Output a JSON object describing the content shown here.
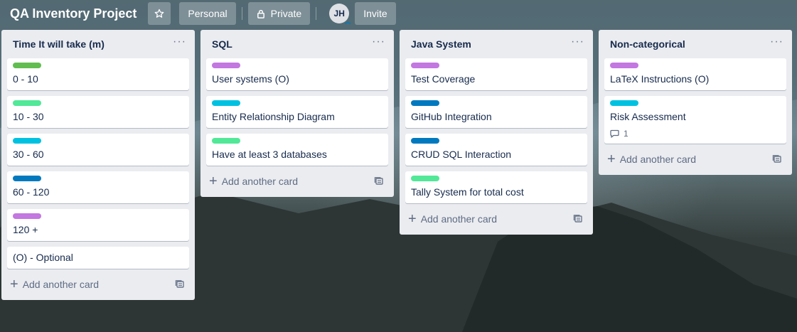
{
  "header": {
    "board_title": "QA Inventory Project",
    "personal_label": "Personal",
    "private_label": "Private",
    "avatar_initials": "JH",
    "invite_label": "Invite"
  },
  "colors": {
    "green": "#61bd4f",
    "lime": "#51e898",
    "sky": "#00c2e0",
    "blue": "#0079bf",
    "purple": "#c377e0"
  },
  "lists": [
    {
      "title": "Time It will take (m)",
      "cards": [
        {
          "label_color": "#61bd4f",
          "text": "0 - 10"
        },
        {
          "label_color": "#51e898",
          "text": "10 - 30"
        },
        {
          "label_color": "#00c2e0",
          "text": "30 - 60"
        },
        {
          "label_color": "#0079bf",
          "text": "60 - 120"
        },
        {
          "label_color": "#c377e0",
          "text": "120 +"
        },
        {
          "label_color": null,
          "text": "(O) - Optional"
        }
      ],
      "add_label": "Add another card"
    },
    {
      "title": "SQL",
      "cards": [
        {
          "label_color": "#c377e0",
          "text": "User systems (O)"
        },
        {
          "label_color": "#00c2e0",
          "text": "Entity Relationship Diagram"
        },
        {
          "label_color": "#51e898",
          "text": "Have at least 3 databases"
        }
      ],
      "add_label": "Add another card"
    },
    {
      "title": "Java System",
      "cards": [
        {
          "label_color": "#c377e0",
          "text": "Test Coverage"
        },
        {
          "label_color": "#0079bf",
          "text": "GitHub Integration"
        },
        {
          "label_color": "#0079bf",
          "text": "CRUD SQL Interaction"
        },
        {
          "label_color": "#51e898",
          "text": "Tally System for total cost"
        }
      ],
      "add_label": "Add another card"
    },
    {
      "title": "Non-categorical",
      "cards": [
        {
          "label_color": "#c377e0",
          "text": "LaTeX Instructions (O)"
        },
        {
          "label_color": "#00c2e0",
          "text": "Risk Assessment",
          "comments": "1"
        }
      ],
      "add_label": "Add another card"
    }
  ]
}
